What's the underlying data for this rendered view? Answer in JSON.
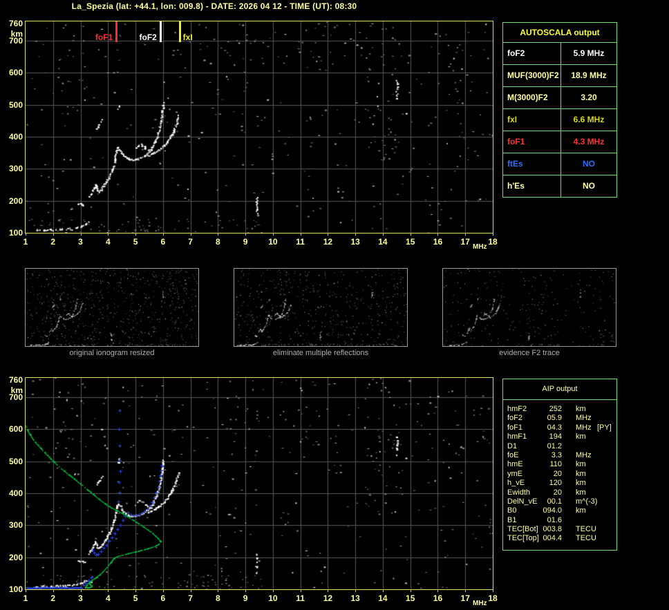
{
  "header": {
    "title": "La_Spezia (lat: +44.1, lon: 009.8) - DATE: 2026 04 12 - TIME (UT): 08:30"
  },
  "colors": {
    "background": "#000000",
    "plot_border": "#e2e25a",
    "grid": "#5a5a5a",
    "axis_text": "#ffff9e",
    "table_border": "#70e070",
    "profile_green": "#00cc42",
    "restored_blue": "#2d47e6",
    "trace_white": "#ffffff",
    "caption_gray": "#b2b2b2"
  },
  "autoscala": {
    "title": "AUTOSCALA output",
    "rows": [
      {
        "label": "foF2",
        "value": "5.9 MHz",
        "color": "#ffffff"
      },
      {
        "label": "MUF(3000)F2",
        "value": "18.9 MHz",
        "color": "#ffffa4"
      },
      {
        "label": "M(3000)F2",
        "value": "3.20",
        "color": "#ffffa4"
      },
      {
        "label": "fxI",
        "value": "6.6 MHz",
        "color": "#d9d912"
      },
      {
        "label": "foF1",
        "value": "4.3 MHz",
        "color": "#ff3434"
      },
      {
        "label": "ftEs",
        "value": "NO",
        "color": "#2e6dff"
      },
      {
        "label": "h'Es",
        "value": "NO",
        "color": "#ffffa4"
      }
    ]
  },
  "aip": {
    "title": "AIP output",
    "rows": [
      {
        "label": "hmF2",
        "value": "252",
        "unit": "km",
        "flag": ""
      },
      {
        "label": "foF2",
        "value": "05.9",
        "unit": "MHz",
        "flag": ""
      },
      {
        "label": "foF1",
        "value": "04.3",
        "unit": "MHz",
        "flag": "[PY]"
      },
      {
        "label": "hmF1",
        "value": "194",
        "unit": "km",
        "flag": ""
      },
      {
        "label": "D1",
        "value": "01.2",
        "unit": "",
        "flag": ""
      },
      {
        "label": "foE",
        "value": "3.3",
        "unit": "MHz",
        "flag": ""
      },
      {
        "label": "hmE",
        "value": "110",
        "unit": "km",
        "flag": ""
      },
      {
        "label": "ymE",
        "value": "20",
        "unit": "km",
        "flag": ""
      },
      {
        "label": "h_vE",
        "value": "120",
        "unit": "km",
        "flag": ""
      },
      {
        "label": "Ewidth",
        "value": "20",
        "unit": "km",
        "flag": ""
      },
      {
        "label": "DelN_vE",
        "value": "00.1",
        "unit": "m^(-3)",
        "flag": ""
      },
      {
        "label": "B0",
        "value": "094.0",
        "unit": "km",
        "flag": ""
      },
      {
        "label": "B1",
        "value": "01.6",
        "unit": "",
        "flag": ""
      },
      {
        "label": "TEC[Bot]",
        "value": "003.8",
        "unit": "TECU",
        "flag": ""
      },
      {
        "label": "TEC[Top]",
        "value": "004.4",
        "unit": "TECU",
        "flag": ""
      }
    ]
  },
  "thumbnails": [
    {
      "caption": "original ionogram resized",
      "seed": 41,
      "noise": 620,
      "clutter": 90,
      "skip": 0.28
    },
    {
      "caption": "eliminate multiple reflections",
      "seed": 55,
      "noise": 500,
      "clutter": 80,
      "skip": 0.3
    },
    {
      "caption": "evidence F2 trace",
      "seed": 67,
      "noise": 240,
      "clutter": 35,
      "skip": 0.42
    }
  ],
  "chart_data": {
    "type": "scatter",
    "title": "ionogram echo traces, height (km) vs frequency (MHz)",
    "x_unit": "MHz",
    "y_unit": "km",
    "x_range": [
      1,
      18
    ],
    "y_range": [
      100,
      760
    ],
    "x_ticks": [
      1,
      2,
      3,
      4,
      5,
      6,
      7,
      8,
      9,
      10,
      11,
      12,
      13,
      14,
      15,
      16,
      17,
      18
    ],
    "y_ticks": [
      760,
      700,
      600,
      500,
      400,
      300,
      200,
      100
    ],
    "grid": true,
    "markers": [
      {
        "label": "foF1",
        "freq_mhz": 4.3,
        "color": "#ff2d2d",
        "label_side": "left"
      },
      {
        "label": "foF2",
        "freq_mhz": 5.9,
        "color": "#ffffff",
        "label_side": "left"
      },
      {
        "label": "fxI",
        "freq_mhz": 6.6,
        "color": "#f0f032",
        "label_side": "right"
      }
    ],
    "echo_trace_segments": [
      {
        "name": "E-layer",
        "style": "sparse",
        "points": [
          [
            1.3,
            107
          ],
          [
            1.42,
            109
          ],
          [
            1.52,
            106
          ],
          [
            1.64,
            110
          ],
          [
            1.76,
            108
          ],
          [
            1.88,
            111
          ],
          [
            2.0,
            108
          ],
          [
            2.1,
            112
          ],
          [
            2.22,
            110
          ],
          [
            2.34,
            114
          ],
          [
            2.45,
            111
          ],
          [
            2.56,
            115
          ],
          [
            2.68,
            113
          ],
          [
            2.8,
            117
          ],
          [
            2.9,
            119
          ],
          [
            3.0,
            121
          ],
          [
            3.1,
            125
          ],
          [
            3.2,
            130
          ],
          [
            3.28,
            136
          ]
        ]
      },
      {
        "name": "Es-segment",
        "style": "sparse",
        "points": [
          [
            2.88,
            193
          ],
          [
            2.98,
            190
          ],
          [
            3.08,
            187
          ],
          [
            3.16,
            185
          ]
        ]
      },
      {
        "name": "F1-trace",
        "style": "solid",
        "points": [
          [
            3.3,
            213
          ],
          [
            3.36,
            222
          ],
          [
            3.42,
            232
          ],
          [
            3.47,
            242
          ],
          [
            3.52,
            250
          ],
          [
            3.56,
            243
          ],
          [
            3.6,
            234
          ],
          [
            3.65,
            229
          ],
          [
            3.72,
            236
          ],
          [
            3.8,
            246
          ],
          [
            3.88,
            256
          ],
          [
            3.96,
            266
          ],
          [
            4.04,
            277
          ],
          [
            4.1,
            289
          ],
          [
            4.16,
            303
          ],
          [
            4.21,
            320
          ],
          [
            4.26,
            340
          ],
          [
            4.3,
            357
          ],
          [
            4.34,
            368
          ],
          [
            4.4,
            363
          ],
          [
            4.47,
            352
          ],
          [
            4.55,
            343
          ],
          [
            4.64,
            337
          ],
          [
            4.74,
            332
          ],
          [
            4.86,
            330
          ],
          [
            4.98,
            331
          ],
          [
            5.1,
            333
          ]
        ]
      },
      {
        "name": "F2-o-asymptote",
        "style": "solid",
        "points": [
          [
            5.18,
            336
          ],
          [
            5.28,
            340
          ],
          [
            5.38,
            346
          ],
          [
            5.48,
            354
          ],
          [
            5.56,
            363
          ],
          [
            5.64,
            374
          ],
          [
            5.71,
            387
          ],
          [
            5.77,
            401
          ],
          [
            5.82,
            416
          ],
          [
            5.87,
            432
          ],
          [
            5.91,
            449
          ],
          [
            5.94,
            465
          ],
          [
            5.96,
            480
          ],
          [
            5.98,
            494
          ],
          [
            6.0,
            506
          ]
        ]
      },
      {
        "name": "F2-x-branch",
        "style": "solid",
        "points": [
          [
            5.42,
            341
          ],
          [
            5.55,
            346
          ],
          [
            5.68,
            352
          ],
          [
            5.8,
            359
          ],
          [
            5.92,
            366
          ],
          [
            6.03,
            374
          ],
          [
            6.13,
            384
          ],
          [
            6.22,
            396
          ],
          [
            6.3,
            409
          ],
          [
            6.38,
            423
          ],
          [
            6.45,
            438
          ],
          [
            6.51,
            453
          ],
          [
            6.55,
            467
          ]
        ]
      },
      {
        "name": "spread-blob",
        "style": "sparse",
        "points": [
          [
            4.98,
            364
          ],
          [
            5.06,
            373
          ],
          [
            5.14,
            380
          ],
          [
            5.24,
            374
          ],
          [
            5.34,
            366
          ],
          [
            5.45,
            360
          ],
          [
            5.55,
            357
          ]
        ]
      },
      {
        "name": "second-hop-arc",
        "style": "sparse",
        "points": [
          [
            3.58,
            426
          ],
          [
            3.63,
            434
          ],
          [
            3.68,
            442
          ],
          [
            3.74,
            450
          ],
          [
            3.8,
            456
          ]
        ]
      },
      {
        "name": "dots-4.4MHz",
        "style": "sparse",
        "points": [
          [
            4.35,
            490
          ],
          [
            4.38,
            500
          ],
          [
            4.36,
            510
          ]
        ]
      },
      {
        "name": "rfi-streak-14.5",
        "style": "sparse",
        "points": [
          [
            14.48,
            518
          ],
          [
            14.5,
            530
          ],
          [
            14.49,
            543
          ],
          [
            14.51,
            556
          ],
          [
            14.5,
            568
          ],
          [
            14.49,
            579
          ]
        ]
      },
      {
        "name": "rfi-streak-9.4",
        "style": "sparse",
        "points": [
          [
            9.4,
            150
          ],
          [
            9.41,
            162
          ],
          [
            9.39,
            175
          ],
          [
            9.41,
            188
          ],
          [
            9.4,
            200
          ],
          [
            9.41,
            213
          ]
        ]
      }
    ],
    "restored_baseline": {
      "km": 106,
      "f_start": 1.0,
      "f_end": 3.04,
      "step": 0.025
    },
    "restored_trace_points": [
      [
        3.1,
        112
      ],
      [
        3.2,
        120
      ],
      [
        3.3,
        128
      ],
      [
        3.38,
        136
      ],
      [
        3.44,
        222
      ],
      [
        3.5,
        214
      ],
      [
        3.57,
        207
      ],
      [
        3.65,
        211
      ],
      [
        3.74,
        219
      ],
      [
        3.84,
        229
      ],
      [
        3.94,
        239
      ],
      [
        4.04,
        251
      ],
      [
        4.14,
        262
      ],
      [
        4.24,
        274
      ],
      [
        4.34,
        287
      ],
      [
        4.44,
        301
      ],
      [
        4.54,
        315
      ],
      [
        4.63,
        329
      ],
      [
        4.72,
        340
      ],
      [
        4.82,
        334
      ],
      [
        4.92,
        330
      ],
      [
        5.02,
        331
      ],
      [
        5.12,
        334
      ],
      [
        5.22,
        338
      ],
      [
        5.32,
        343
      ],
      [
        5.42,
        350
      ],
      [
        5.52,
        360
      ],
      [
        5.61,
        372
      ],
      [
        5.69,
        386
      ],
      [
        5.76,
        402
      ],
      [
        5.82,
        419
      ],
      [
        5.87,
        437
      ],
      [
        5.91,
        455
      ],
      [
        5.94,
        471
      ],
      [
        5.96,
        486
      ],
      [
        4.38,
        374
      ],
      [
        4.42,
        402
      ],
      [
        4.4,
        434
      ],
      [
        4.44,
        468
      ],
      [
        4.41,
        504
      ],
      [
        4.43,
        548
      ],
      [
        4.4,
        600
      ],
      [
        4.42,
        658
      ]
    ],
    "density_profile_points": [
      [
        1.0,
        611
      ],
      [
        1.06,
        597
      ],
      [
        1.14,
        585
      ],
      [
        1.24,
        572
      ],
      [
        1.36,
        558
      ],
      [
        1.52,
        543
      ],
      [
        1.7,
        526
      ],
      [
        1.9,
        509
      ],
      [
        2.1,
        492
      ],
      [
        2.32,
        475
      ],
      [
        2.55,
        459
      ],
      [
        2.78,
        444
      ],
      [
        3.0,
        429
      ],
      [
        3.22,
        413
      ],
      [
        3.45,
        397
      ],
      [
        3.68,
        381
      ],
      [
        3.9,
        367
      ],
      [
        4.1,
        356
      ],
      [
        4.3,
        347
      ],
      [
        4.5,
        338
      ],
      [
        4.7,
        328
      ],
      [
        4.9,
        317
      ],
      [
        5.1,
        306
      ],
      [
        5.28,
        296
      ],
      [
        5.45,
        286
      ],
      [
        5.6,
        276
      ],
      [
        5.72,
        267
      ],
      [
        5.81,
        260
      ],
      [
        5.87,
        254
      ],
      [
        5.89,
        249
      ],
      [
        5.85,
        243
      ],
      [
        5.76,
        238
      ],
      [
        5.62,
        233
      ],
      [
        5.44,
        228
      ],
      [
        5.22,
        223
      ],
      [
        4.98,
        218
      ],
      [
        4.74,
        213
      ],
      [
        4.52,
        208
      ],
      [
        4.34,
        204
      ],
      [
        4.22,
        199
      ],
      [
        4.15,
        192
      ],
      [
        4.08,
        184
      ],
      [
        4.0,
        175
      ],
      [
        3.9,
        165
      ],
      [
        3.8,
        156
      ],
      [
        3.7,
        148
      ],
      [
        3.6,
        141
      ],
      [
        3.5,
        135
      ],
      [
        3.42,
        130
      ],
      [
        3.34,
        125
      ],
      [
        3.3,
        120
      ],
      [
        3.34,
        115
      ],
      [
        3.4,
        112
      ],
      [
        3.35,
        108
      ],
      [
        3.25,
        105
      ],
      [
        3.17,
        108
      ],
      [
        3.21,
        114
      ],
      [
        3.27,
        120
      ]
    ],
    "noise": {
      "main_seed": 11,
      "bottom_seed": 29,
      "main_count": 330,
      "clutter_count": 80,
      "rfi_columns": [
        [
          13.3,
          14.7,
          330,
          760,
          42
        ],
        [
          2.0,
          3.2,
          450,
          760,
          24
        ],
        [
          8.2,
          9.7,
          530,
          760,
          16
        ],
        [
          10.9,
          12.3,
          560,
          745,
          14
        ],
        [
          15.6,
          16.9,
          430,
          740,
          14
        ]
      ]
    }
  }
}
